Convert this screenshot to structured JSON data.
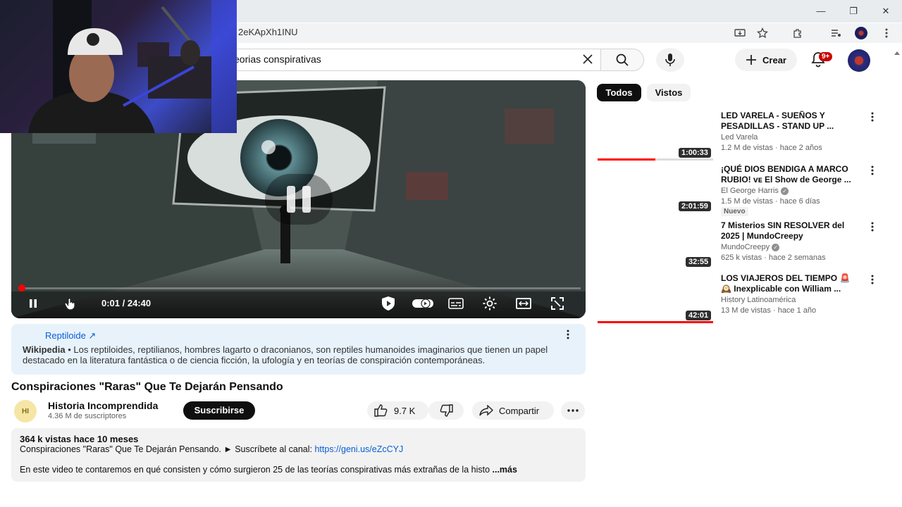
{
  "browser": {
    "url": "2eKApXh1INU",
    "window_controls": [
      "—",
      "❐",
      "✕"
    ]
  },
  "header": {
    "search_value": "eorias conspirativas",
    "create_label": "Crear",
    "notifications_badge": "9+"
  },
  "player": {
    "time": "0:01 / 24:40",
    "progress": 0.001
  },
  "info_panel": {
    "link_label": "Reptiloide ↗",
    "source": "Wikipedia",
    "text": "Los reptiloides, reptilianos, hombres lagarto o draconianos, son reptiles humanoides imaginarios que tienen un papel destacado en la literatura fantástica o de ciencia ficción, la ufología y en teorías de conspiración contemporáneas."
  },
  "video": {
    "title": "Conspiraciones \"Raras\" Que Te Dejarán Pensando",
    "channel_name": "Historia Incomprendida",
    "channel_subs": "4.36 M de suscriptores",
    "subscribe_label": "Suscribirse",
    "likes": "9.7 K",
    "share_label": "Compartir"
  },
  "description": {
    "meta": "364 k vistas  hace 10 meses",
    "line1_text": "Conspiraciones \"Raras\" Que Te Dejarán Pensando.   ► Suscríbete al canal: ",
    "line1_link": "https://geni.us/eZcCYJ",
    "line2": "En este video te contaremos en qué consisten y cómo surgieron 25 de las teorías conspirativas más extrañas de la histo",
    "more_label": "...más"
  },
  "chips": [
    "Todos",
    "Vistos"
  ],
  "recommendations": [
    {
      "title": "LED VARELA - SUEÑOS Y PESADILLAS - STAND UP ...",
      "channel": "Led Varela",
      "stats": "1.2 M de vistas · hace 2 años",
      "duration": "1:00:33",
      "watched": 0.5
    },
    {
      "title": "¡QUÉ DIOS BENDIGA A MARCO RUBIO! ᴠᴇ El Show de George ...",
      "channel": "El George Harris",
      "stats": "1.5 M de vistas · hace 6 días",
      "duration": "2:01:59",
      "badge": "Nuevo",
      "watched": 0
    },
    {
      "title": "7 Misterios SIN RESOLVER del 2025 | MundoCreepy",
      "channel": "MundoCreepy",
      "stats": "625 k vistas · hace 2 semanas",
      "duration": "32:55",
      "watched": 0
    },
    {
      "title": "LOS VIAJEROS DEL TIEMPO 🚨 🕰️ Inexplicable con William ...",
      "channel": "History Latinoamérica",
      "stats": "13 M de vistas · hace 1 año",
      "duration": "42:01",
      "watched": 1.0
    }
  ],
  "colors": {
    "accent_red": "#ff0000",
    "link_blue": "#065fd4",
    "info_panel_bg": "#e8f2fb"
  }
}
